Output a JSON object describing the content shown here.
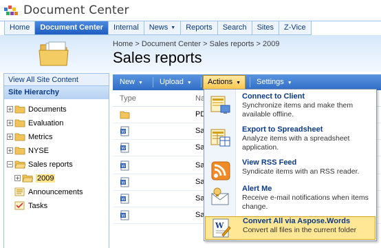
{
  "site": {
    "title": "Document Center"
  },
  "topnav": {
    "tabs": [
      {
        "label": "Home"
      },
      {
        "label": "Document Center",
        "active": true
      },
      {
        "label": "Internal"
      },
      {
        "label": "News",
        "has_dropdown": true
      },
      {
        "label": "Reports"
      },
      {
        "label": "Search"
      },
      {
        "label": "Sites"
      },
      {
        "label": "Z-Vice"
      }
    ]
  },
  "header": {
    "breadcrumb": "Home > Document Center > Sales reports > 2009",
    "title": "Sales reports"
  },
  "leftnav": {
    "view_all": "View All Site Content",
    "hierarchy_title": "Site Hierarchy",
    "items": [
      {
        "label": "Documents"
      },
      {
        "label": "Evaluation"
      },
      {
        "label": "Metrics"
      },
      {
        "label": "NYSE"
      },
      {
        "label": "Sales reports"
      },
      {
        "label": "2009"
      },
      {
        "label": "Announcements"
      },
      {
        "label": "Tasks"
      }
    ]
  },
  "toolbar": {
    "new": "New",
    "upload": "Upload",
    "actions": "Actions",
    "settings": "Settings"
  },
  "list": {
    "col_type": "Type",
    "col_name": "Na",
    "rows": [
      {
        "type": "folder",
        "name": "PD"
      },
      {
        "type": "word-doc",
        "name": "Sa"
      },
      {
        "type": "word-doc",
        "name": "Sa"
      },
      {
        "type": "word-doc",
        "name": "Sa"
      },
      {
        "type": "word-doc",
        "name": "Sa"
      },
      {
        "type": "word-doc",
        "name": "Sa"
      },
      {
        "type": "word-doc",
        "name": "Sa"
      }
    ]
  },
  "actions_menu": {
    "items": [
      {
        "icon": "connect-client-icon",
        "title": "Connect to Client",
        "desc": "Synchronize items and make them available offline."
      },
      {
        "icon": "spreadsheet-icon",
        "title": "Export to Spreadsheet",
        "desc": "Analyze items with a spreadsheet application."
      },
      {
        "icon": "rss-icon",
        "title": "View RSS Feed",
        "desc": "Syndicate items with an RSS reader."
      },
      {
        "icon": "alert-icon",
        "title": "Alert Me",
        "desc": "Receive e-mail notifications when items change."
      },
      {
        "icon": "aspose-words-icon",
        "title": "Convert All via Aspose.Words",
        "desc": "Convert all files in the current folder",
        "highlighted": true
      }
    ]
  },
  "colors": {
    "accent_blue": "#2164c8",
    "link_blue": "#0b3a87",
    "highlight_yellow": "#ffe795"
  }
}
